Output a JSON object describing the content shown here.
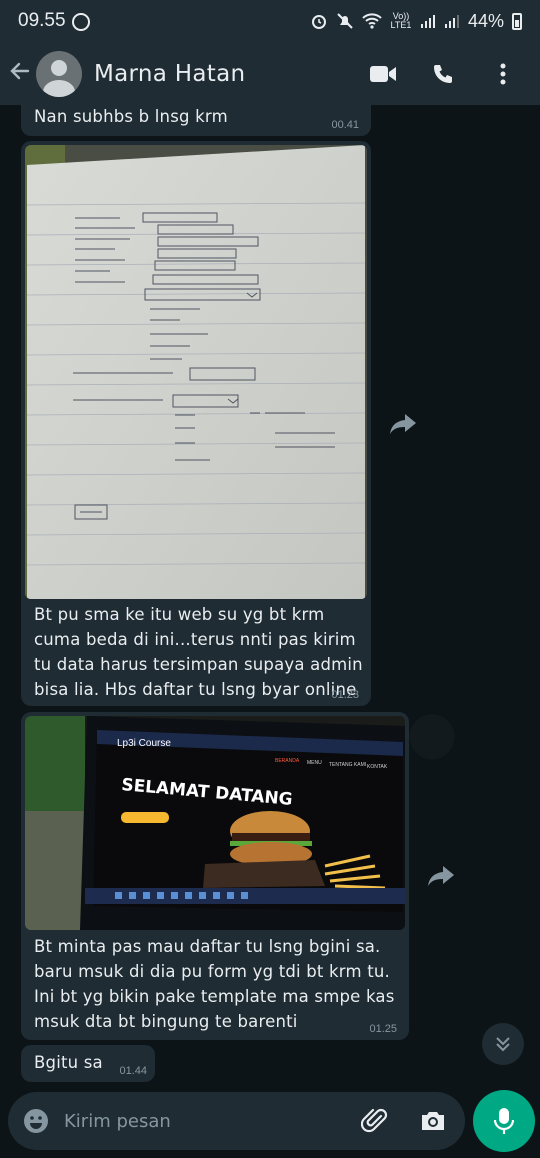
{
  "status_bar": {
    "time": "09.55",
    "network_label": "Vo)) LTE1",
    "battery": "44%"
  },
  "header": {
    "contact_name": "Marna Hatan",
    "icons": [
      "back-arrow-icon",
      "video-call-icon",
      "voice-call-icon",
      "more-options-icon"
    ]
  },
  "messages": [
    {
      "text": "Nan subhbs b lnsg krm",
      "time": "00.41"
    },
    {
      "type": "image",
      "caption": "Bt pu sma ke itu web su yg bt krm cuma beda di ini...terus nnti pas kirim tu data harus tersimpan supaya admin bisa  lia. Hbs daftar tu lsng byar online",
      "time": "01.23"
    },
    {
      "type": "image",
      "screen_brand": "Lp3i Course",
      "screen_headline": "SELAMAT DATANG",
      "screen_nav": [
        "BERANDA",
        "MENU",
        "TENTANG KAMI",
        "KONTAK"
      ],
      "caption": "Bt minta pas mau daftar tu lsng bgini sa. baru msuk di dia pu form yg tdi bt krm tu. Ini bt yg bikin pake template ma smpe kas msuk dta bt bingung te barenti",
      "time": "01.25"
    },
    {
      "text": "Bgitu sa",
      "time": "01.44"
    }
  ],
  "composer": {
    "placeholder": "Kirim pesan"
  },
  "colors": {
    "background": "#0b141a",
    "bubble": "#1f2c34",
    "accent": "#00a884",
    "meta": "#8696a0"
  }
}
